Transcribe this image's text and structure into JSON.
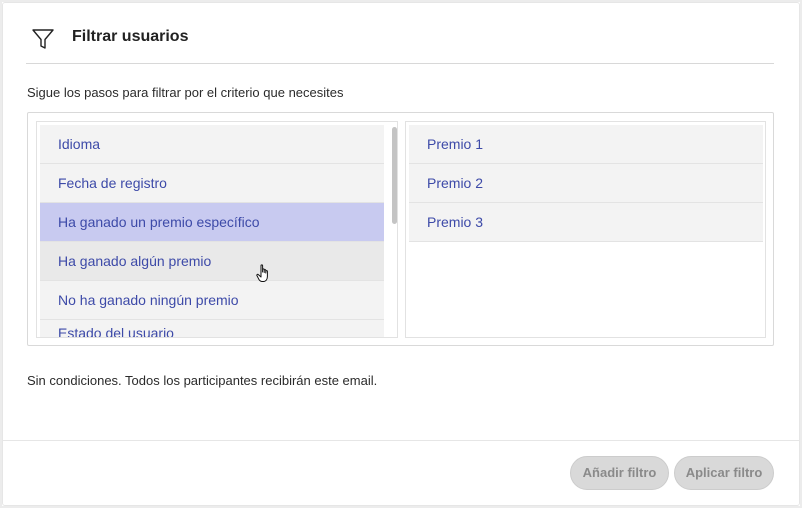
{
  "header": {
    "title": "Filtrar usuarios",
    "icon": "funnel-icon"
  },
  "instructions": "Sigue los pasos para filtrar por el criterio que necesites",
  "criteria": {
    "items": [
      "Idioma",
      "Fecha de registro",
      "Ha ganado un premio específico",
      "Ha ganado algún premio",
      "No ha ganado ningún premio",
      "Estado del usuario"
    ],
    "selected": "Ha ganado un premio específico",
    "hovered": "Ha ganado algún premio"
  },
  "options": {
    "items": [
      "Premio 1",
      "Premio 2",
      "Premio 3"
    ]
  },
  "status": "Sin condiciones. Todos los participantes recibirán este email.",
  "footer": {
    "add_label": "Añadir filtro",
    "apply_label": "Aplicar filtro"
  },
  "colors": {
    "item_text": "#3d4aa8",
    "selected_bg": "#c8caf0",
    "button_bg": "#d9d9d9"
  }
}
